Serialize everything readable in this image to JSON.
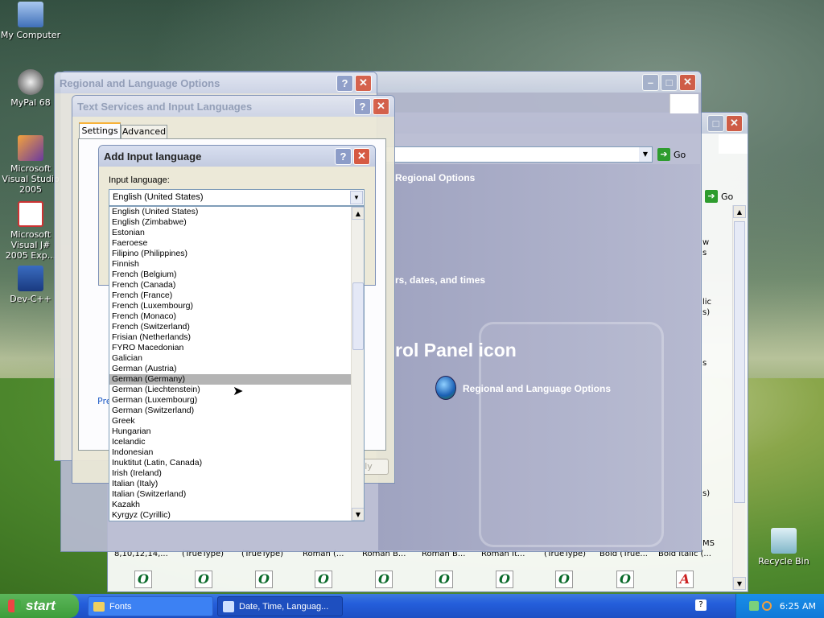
{
  "desktop": {
    "icons": [
      {
        "label": "My Computer"
      },
      {
        "label": "MyPal 68"
      },
      {
        "label": "Microsoft Visual Studio 2005"
      },
      {
        "label": "Microsoft Visual J# 2005 Exp..."
      },
      {
        "label": "Dev-C++"
      },
      {
        "label": "Recycle Bin"
      }
    ]
  },
  "control_panel": {
    "go_label": "Go",
    "regional_options": "Regional Options",
    "pick_task": "rs, dates, and times",
    "pick_icon": "rol Panel icon",
    "item_label": "Regional and Language Options"
  },
  "fonts_window": {
    "go_label": "Go",
    "side_texts": [
      "w",
      "s",
      "lic",
      "s)",
      "s",
      "s)",
      "MS"
    ],
    "font_labels": [
      "8,10,12,14,...",
      "(TrueType)",
      "(TrueType)",
      "Roman (...",
      "Roman B...",
      "Roman B...",
      "Roman It...",
      "(TrueType)",
      "Bold (True...",
      "Bold Italic (..."
    ]
  },
  "regional_window": {
    "title": "Regional and Language Options"
  },
  "text_services": {
    "title": "Text Services and Input Languages",
    "tabs": [
      "Settings",
      "Advanced"
    ],
    "pref_label": "Pre",
    "apply_label": "ly"
  },
  "add_input": {
    "title": "Add Input language",
    "input_label": "Input language:",
    "selected": "English (United States)",
    "list": [
      "English (United States)",
      "English (Zimbabwe)",
      "Estonian",
      "Faeroese",
      "Filipino (Philippines)",
      "Finnish",
      "French (Belgium)",
      "French (Canada)",
      "French (France)",
      "French (Luxembourg)",
      "French (Monaco)",
      "French (Switzerland)",
      "Frisian (Netherlands)",
      "FYRO Macedonian",
      "Galician",
      "German (Austria)",
      "German (Germany)",
      "German (Liechtenstein)",
      "German (Luxembourg)",
      "German (Switzerland)",
      "Greek",
      "Hungarian",
      "Icelandic",
      "Indonesian",
      "Inuktitut (Latin, Canada)",
      "Irish (Ireland)",
      "Italian (Italy)",
      "Italian (Switzerland)",
      "Kazakh",
      "Kyrgyz (Cyrillic)"
    ],
    "highlighted": "German (Germany)"
  },
  "taskbar": {
    "start_label": "start",
    "tasks": [
      {
        "label": "Fonts"
      },
      {
        "label": "Date, Time, Languag..."
      }
    ],
    "clock": "6:25 AM"
  }
}
